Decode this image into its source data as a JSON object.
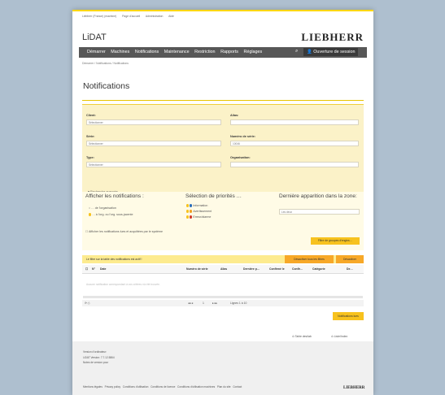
{
  "topbar": {
    "links": [
      "Liebherr (France) (machine)",
      "Page d'accueil",
      "Administration",
      "Aide"
    ]
  },
  "app": {
    "title": "LiDAT",
    "logo": "LIEBHERR"
  },
  "nav": {
    "items": [
      "Démarrer",
      "Machines",
      "Notifications",
      "Maintenance",
      "Restriction",
      "Rapports",
      "Réglages"
    ],
    "login": "Ouverture de session"
  },
  "breadcrumb": "Démarrer / Notifications / Notifications",
  "page_title": "Notifications",
  "filters": {
    "client": {
      "label": "Client:",
      "value": "Sélectionner"
    },
    "alias": {
      "label": "Alias:",
      "value": ""
    },
    "serie": {
      "label": "Série:",
      "value": "Sélectionner"
    },
    "numero_serie": {
      "label": "Numéro de série:",
      "value": "10046"
    },
    "type": {
      "label": "Type:",
      "value": "Sélectionner"
    },
    "organisation": {
      "label": "Organisation:",
      "value": ""
    },
    "advanced": "Recherche avancée"
  },
  "options": {
    "display_title": "Afficher les notifications :",
    "display_opts": [
      "… de l'organisation",
      "… à l'org. ou l'org. sous-jacente"
    ],
    "priority_title": "Sélection de priorités …",
    "priority_opts": [
      "Information",
      "Avertissement",
      "Erreur/alarme"
    ],
    "priority_colors": [
      "#2a6ebb",
      "#f0a020",
      "#d23a2a"
    ],
    "zone_title": "Dernière apparition dans la zone:",
    "zone_value": "Les deux",
    "checkbox": "Afficher les notifications lues et acquittées par le système",
    "filter_btn": "Filtre de groupes d'engins…"
  },
  "notice": {
    "text": "Le filtre sur la table des notifications est actif !",
    "reset_btn": "Désactiver tous les filtres",
    "close_btn": "Désactiver"
  },
  "table": {
    "headers": [
      "N°",
      "Date",
      "Numéro de série",
      "Alias",
      "Dernière p…",
      "Confirmé le",
      "Confir…",
      "Catégorie",
      "De…"
    ],
    "empty": "Aucune notification correspondant à vos critères n'a été trouvée.",
    "page": "1",
    "rows_label": "Lignes 1 à 10"
  },
  "notifications_btn": "Notifications lues",
  "links": [
    "Table des/tab",
    "Liste/Index"
  ],
  "footer": {
    "title": "Version d'ordinateur:",
    "version": "LiDAT Version: 7.7.12.5864",
    "note": "Notes de version pour",
    "links": [
      "Mentions légales",
      "Privacy policy",
      "Conditions d'utilisation",
      "Conditions de licence",
      "Conditions d'utilisation machines",
      "Plan du site",
      "Contact"
    ]
  }
}
